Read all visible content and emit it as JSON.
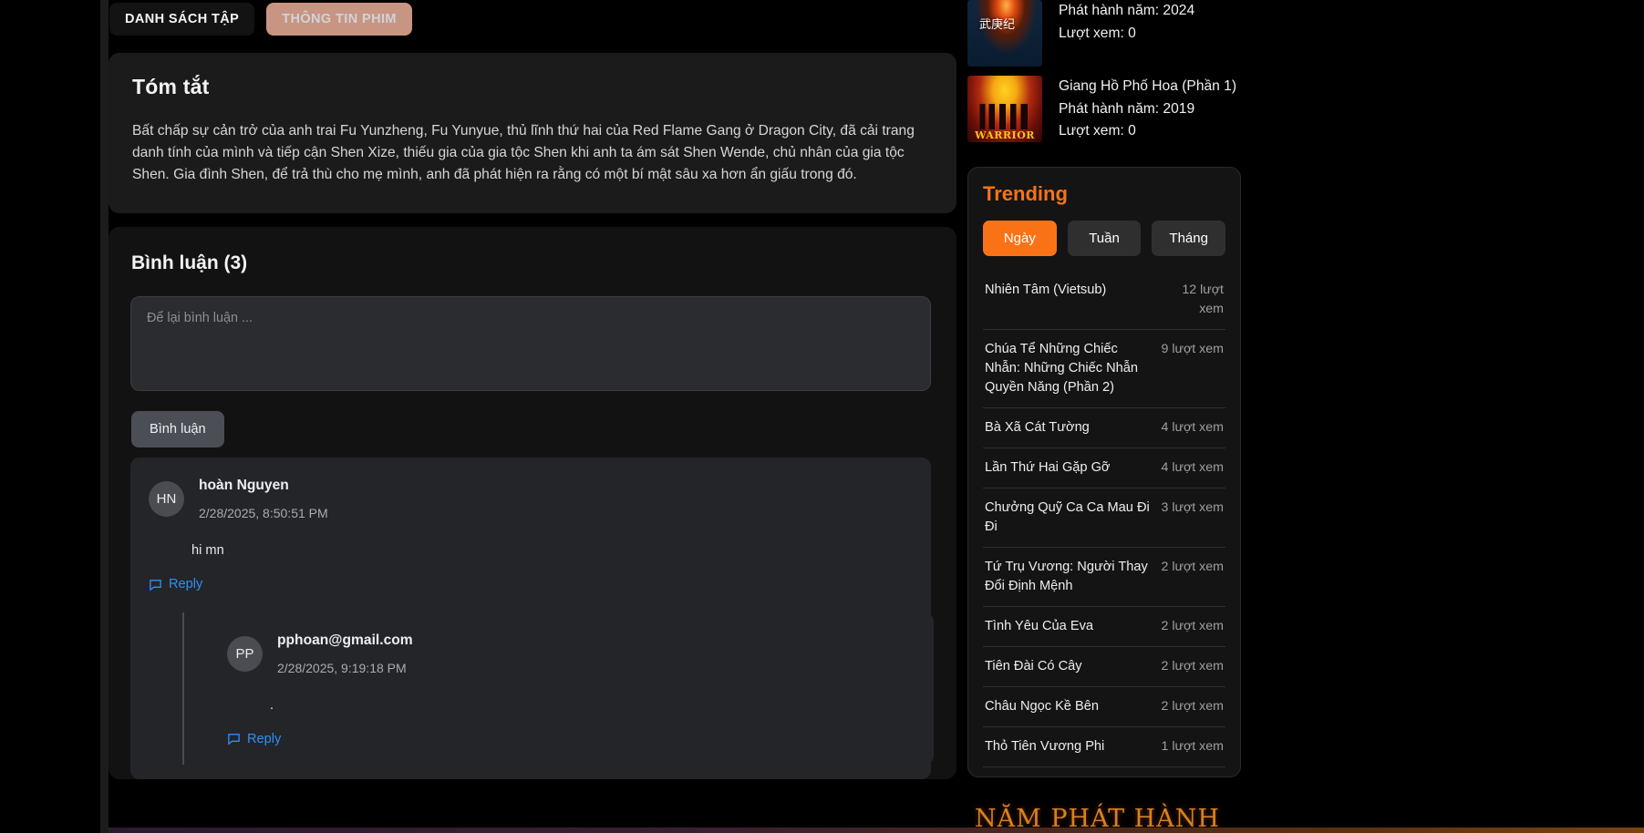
{
  "tabs": [
    {
      "label": "DANH SÁCH TẬP",
      "active": false
    },
    {
      "label": "THÔNG TIN PHIM",
      "active": true
    }
  ],
  "summary": {
    "heading": "Tóm tắt",
    "text": "Bất chấp sự cản trở của anh trai Fu Yunzheng, Fu Yunyue, thủ lĩnh thứ hai của Red Flame Gang ở Dragon City, đã cải trang danh tính của mình và tiếp cận Shen Xize, thiếu gia của gia tộc Shen khi anh ta ám sát Shen Wende, chủ nhân của gia tộc Shen. Gia đình Shen, để trả thù cho mẹ mình, anh đã phát hiện ra rằng có một bí mật sâu xa hơn ẩn giấu trong đó."
  },
  "comments": {
    "heading": "Bình luận (3)",
    "input_placeholder": "Để lại bình luận ...",
    "input_value": "",
    "submit_label": "Bình luận",
    "reply_label": "Reply",
    "items": [
      {
        "initials": "HN",
        "name": "hoàn Nguyen",
        "date": "2/28/2025, 8:50:51 PM",
        "body": "hi mn"
      },
      {
        "initials": "PP",
        "name": "pphoan@gmail.com",
        "date": "2/28/2025, 9:19:18 PM",
        "body": "."
      }
    ]
  },
  "sidebar": {
    "movies": [
      {
        "poster": "wu-geng-ji-poster",
        "poster_text": "武庚纪",
        "title": "",
        "year_label": "Phát hành năm: 2024",
        "views_label": "Lượt xem: 0"
      },
      {
        "poster": "warrior-poster",
        "poster_text": "WARRIOR",
        "title": "Giang Hồ Phố Hoa (Phần 1)",
        "year_label": "Phát hành năm: 2019",
        "views_label": "Lượt xem: 0"
      }
    ],
    "trending": {
      "title": "Trending",
      "accent_color": "#f97316",
      "periods": [
        {
          "label": "Ngày",
          "active": true
        },
        {
          "label": "Tuần",
          "active": false
        },
        {
          "label": "Tháng",
          "active": false
        }
      ],
      "items": [
        {
          "title": "Nhiên Tâm (Vietsub)",
          "views": "12 lượt xem"
        },
        {
          "title": "Chúa Tể Những Chiếc Nhẫn: Những Chiếc Nhẫn Quyền Năng (Phần 2)",
          "views": "9 lượt xem"
        },
        {
          "title": "Bà Xã Cát Tường",
          "views": "4 lượt xem"
        },
        {
          "title": "Lần Thứ Hai Gặp Gỡ",
          "views": "4 lượt xem"
        },
        {
          "title": "Chưởng Quỹ Ca Ca Mau Đi Đi",
          "views": "3 lượt xem"
        },
        {
          "title": "Tứ Trụ Vương: Người Thay Đổi Định Mệnh",
          "views": "2 lượt xem"
        },
        {
          "title": "Tình Yêu Của Eva",
          "views": "2 lượt xem"
        },
        {
          "title": "Tiên Đài Có Cây",
          "views": "2 lượt xem"
        },
        {
          "title": "Châu Ngọc Kề Bên",
          "views": "2 lượt xem"
        },
        {
          "title": "Thỏ Tiên Vương Phi",
          "views": "1 lượt xem"
        }
      ]
    },
    "year_banner": "NĂM PHÁT HÀNH"
  }
}
